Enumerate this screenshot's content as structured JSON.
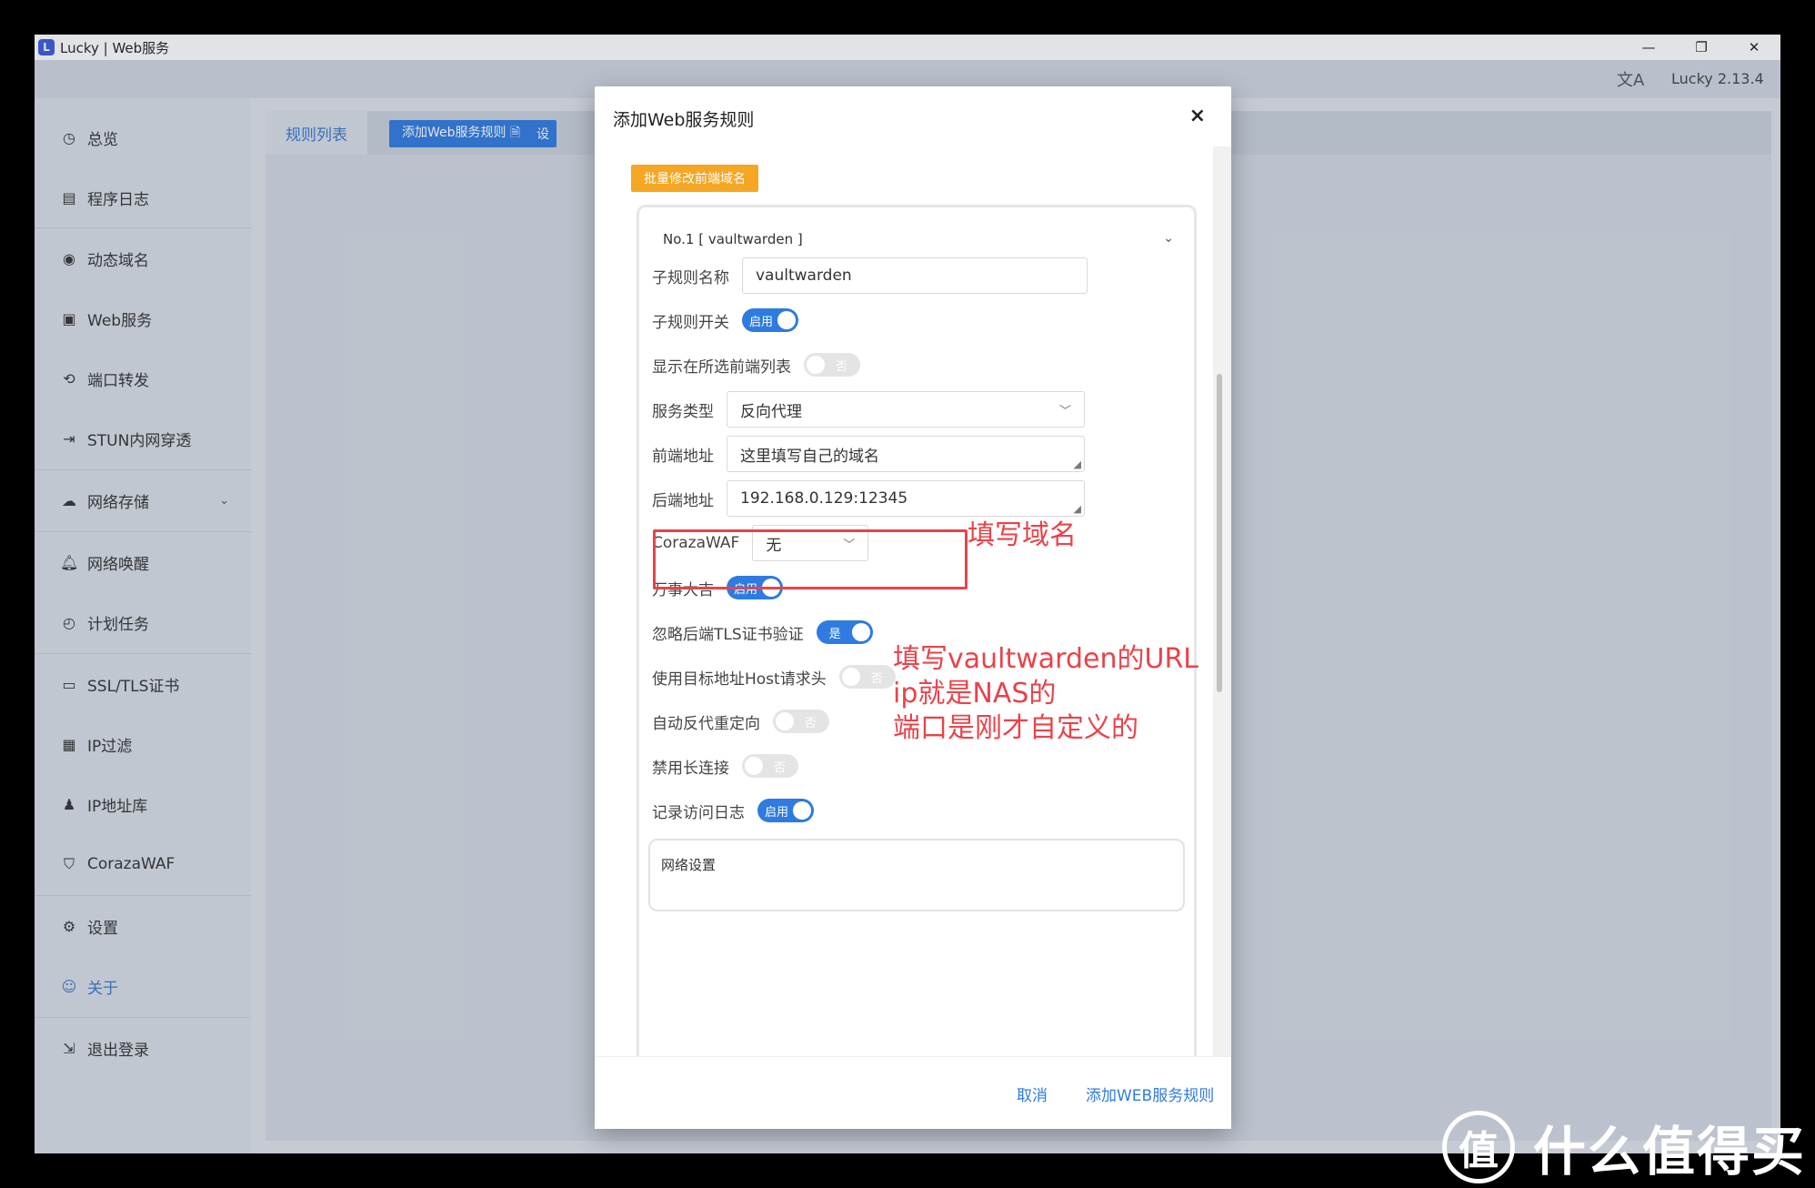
{
  "window": {
    "app_icon_glyph": "L",
    "title": "Lucky | Web服务",
    "version": "Lucky 2.13.4",
    "controls": [
      "—",
      "❐",
      "✕"
    ]
  },
  "sidebar": {
    "items": [
      {
        "label": "总览",
        "icon": "dashboard-icon"
      },
      {
        "label": "程序日志",
        "icon": "log-icon"
      },
      {
        "label": "动态域名",
        "icon": "dns-icon"
      },
      {
        "label": "Web服务",
        "icon": "web-icon"
      },
      {
        "label": "端口转发",
        "icon": "port-forward-icon"
      },
      {
        "label": "STUN内网穿透",
        "icon": "stun-icon"
      },
      {
        "label": "网络存储",
        "icon": "cloud-icon"
      },
      {
        "label": "网络唤醒",
        "icon": "bell-icon"
      },
      {
        "label": "计划任务",
        "icon": "clock-icon"
      },
      {
        "label": "SSL/TLS证书",
        "icon": "certificate-icon"
      },
      {
        "label": "IP过滤",
        "icon": "ip-filter-icon"
      },
      {
        "label": "IP地址库",
        "icon": "user-pin-icon"
      },
      {
        "label": "CorazaWAF",
        "icon": "shield-icon"
      },
      {
        "label": "设置",
        "icon": "gear-icon"
      },
      {
        "label": "关于",
        "icon": "about-icon"
      },
      {
        "label": "退出登录",
        "icon": "logout-icon"
      }
    ]
  },
  "main": {
    "tab_rules": "规则列表",
    "add_web_rule_btn": "添加Web服务规则 🗎",
    "third_btn": "设"
  },
  "dialog": {
    "title": "添加Web服务规则",
    "close": "×",
    "batch_btn": "批量修改前端域名",
    "subrule_header": "No.1 [ vaultwarden ]",
    "fields": {
      "subrule_name_label": "子规则名称",
      "subrule_name_value": "vaultwarden",
      "subrule_switch_label": "子规则开关",
      "subrule_switch_state": "启用",
      "show_frontend_label": "显示在所选前端列表",
      "show_frontend_state": "否",
      "service_type_label": "服务类型",
      "service_type_value": "反向代理",
      "frontend_label": "前端地址",
      "frontend_value": "这里填写自己的域名",
      "backend_label": "后端地址",
      "backend_value": "192.168.0.129:12345",
      "waf_label": "CorazaWAF",
      "waf_value": "无",
      "wanshi_label": "万事大吉",
      "wanshi_state": "启用",
      "ignore_tls_label": "忽略后端TLS证书验证",
      "ignore_tls_state": "是",
      "use_host_label": "使用目标地址Host请求头",
      "use_host_state": "否",
      "auto_redirect_label": "自动反代重定向",
      "auto_redirect_state": "否",
      "disable_keepalive_label": "禁用长连接",
      "disable_keepalive_state": "否",
      "access_log_label": "记录访问日志",
      "access_log_state": "启用"
    },
    "network_settings_title": "网络设置",
    "cancel_btn": "取消",
    "submit_btn": "添加WEB服务规则"
  },
  "annotations": {
    "fill_domain": "填写域名",
    "fill_url_line1": "填写vaultwarden的URL",
    "fill_url_line2": "ip就是NAS的",
    "fill_url_line3": "端口是刚才自定义的"
  },
  "watermark": {
    "logo_glyph": "值",
    "text": "什么值得买"
  },
  "colors": {
    "accent": "#2f7be0",
    "batch_orange": "#f5a623",
    "annotation_red": "#e8434a"
  }
}
